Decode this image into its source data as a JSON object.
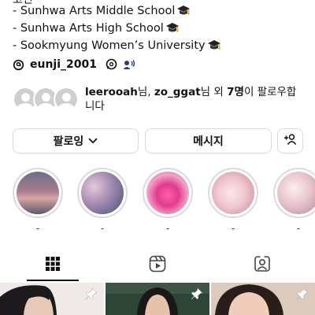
{
  "bio": {
    "top_fragment": "고민",
    "lines": [
      {
        "text": "- Sunhwa Arts Middle School"
      },
      {
        "text": "- Sunhwa Arts High School"
      },
      {
        "text": "- Sookmyung Women’s University"
      }
    ]
  },
  "threads": {
    "handle": "eunji_2001",
    "icons": [
      "threads-icon",
      "thread-bubble-icon",
      "voice-icon"
    ]
  },
  "followers": {
    "name1": "leerooah",
    "sep1": "님, ",
    "name2": "zo_ggat",
    "sep2": "님 외 ",
    "count": "7명",
    "suffix": "이 팔로우합니다"
  },
  "actions": {
    "follow_label": "팔로잉",
    "message_label": "메시지"
  },
  "highlights": [
    {
      "label": "-"
    },
    {
      "label": "-"
    },
    {
      "label": "-"
    },
    {
      "label": "-"
    },
    {
      "label": "-"
    }
  ],
  "tabs": [
    "posts-grid-tab",
    "reels-tab",
    "tagged-tab"
  ],
  "colors": {
    "text": "#111111",
    "border": "#dbdbdb",
    "muted": "#444444"
  }
}
